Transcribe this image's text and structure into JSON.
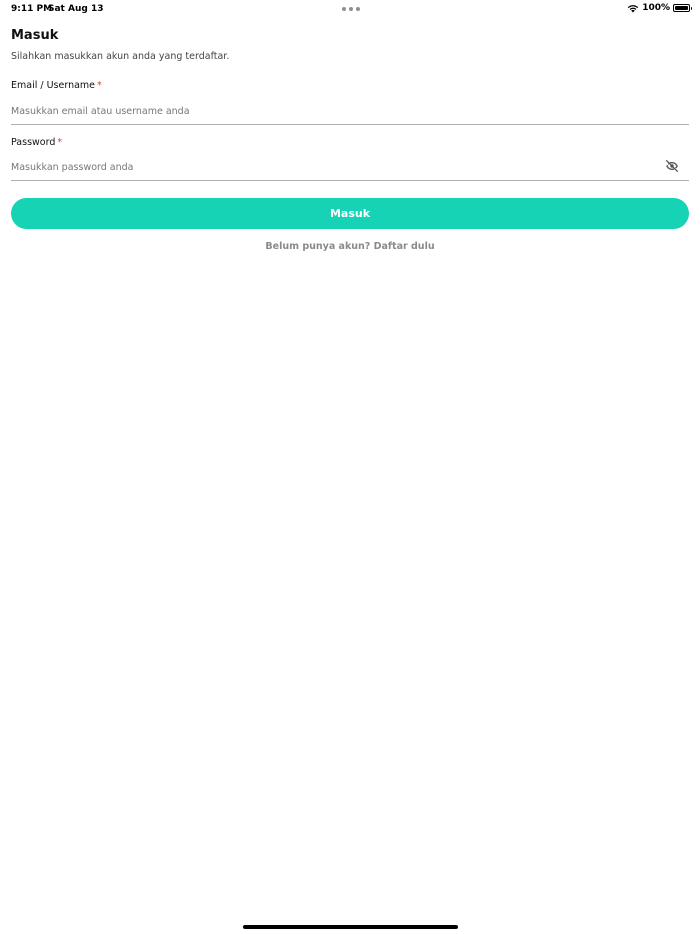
{
  "status_bar": {
    "time": "9:11 PM",
    "date": "Sat Aug 13",
    "battery_text": "100%",
    "battery_level": 1.0
  },
  "login": {
    "title": "Masuk",
    "subtitle": "Silahkan masukkan akun anda yang terdaftar.",
    "email_label": "Email / Username",
    "email_required_mark": "*",
    "email_placeholder": "Masukkan email atau username anda",
    "email_value": "",
    "password_label": "Password",
    "password_required_mark": "*",
    "password_placeholder": "Masukkan password anda",
    "password_value": "",
    "password_toggle_icon": "eye-off-icon",
    "submit_label": "Masuk",
    "register_link": "Belum punya akun? Daftar dulu"
  },
  "colors": {
    "primary": "#17d3b5",
    "required": "#e53935",
    "link": "#8a8a8a"
  }
}
